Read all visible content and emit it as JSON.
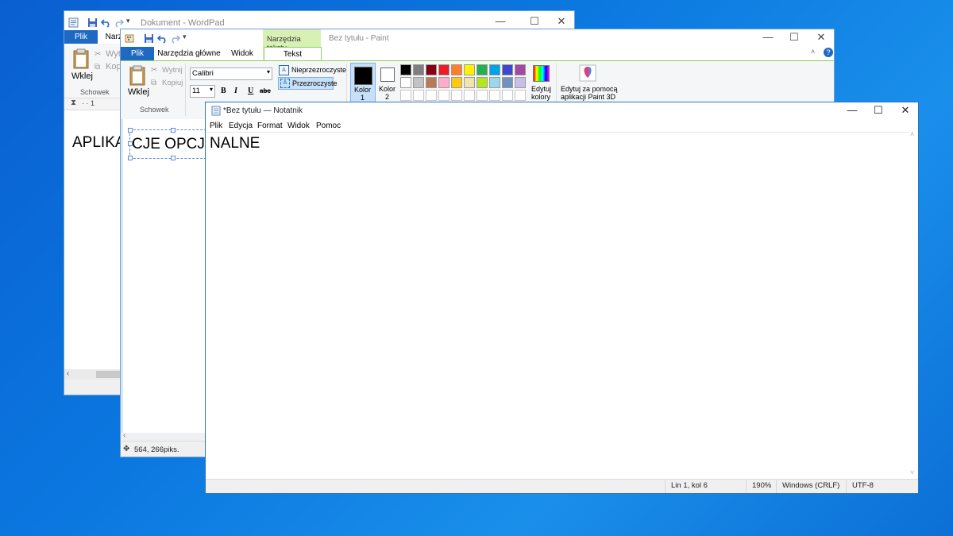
{
  "wordpad": {
    "title": "Dokument - WordPad",
    "tabs": [
      "Plik",
      "Narzę"
    ],
    "paste_label": "Wklej",
    "cut_label": "Wytn",
    "copy_label": "Kopi",
    "group_label": "Schowek",
    "doc_text": "APLIKA",
    "ruler_text": "· · 1"
  },
  "paint": {
    "title": "Bez tytułu - Paint",
    "context_tab": "Narzędzia tekstu",
    "tabs": [
      "Plik",
      "Narzędzia główne",
      "Widok",
      "Tekst"
    ],
    "paste_label": "Wklej",
    "cut_label": "Wytnij",
    "copy_label": "Kopiuj",
    "clipboard_group": "Schowek",
    "font_name": "Calibri",
    "font_size": "11",
    "bold": "B",
    "italic": "I",
    "underline": "U",
    "strike": "abc",
    "opaque_label": "Nieprzezroczyste",
    "transparent_label": "Przezroczyste",
    "color1_label": "Kolor",
    "color1_num": "1",
    "color2_label": "Kolor",
    "color2_num": "2",
    "edit_colors_label1": "Edytuj",
    "edit_colors_label2": "kolory",
    "paint3d_label1": "Edytuj za pomocą",
    "paint3d_label2": "aplikacji Paint 3D",
    "canvas_text": "CJE OPCJO",
    "status_coords": "564, 266piks.",
    "palette_row1": [
      "#000000",
      "#7f7f7f",
      "#880015",
      "#ed1c24",
      "#ff7f27",
      "#fff200",
      "#22b14c",
      "#00a2e8",
      "#3f48cc",
      "#a349a4"
    ],
    "palette_row2": [
      "#ffffff",
      "#c3c3c3",
      "#b97a57",
      "#ffaec9",
      "#ffc90e",
      "#efe4b0",
      "#b5e61d",
      "#99d9ea",
      "#7092be",
      "#c8bfe7"
    ],
    "palette_row3": [
      "#ffffff",
      "#ffffff",
      "#ffffff",
      "#ffffff",
      "#ffffff",
      "#ffffff",
      "#ffffff",
      "#ffffff",
      "#ffffff",
      "#ffffff"
    ],
    "color1_hex": "#000000",
    "color2_hex": "#ffffff",
    "accent": "#0b6cc8"
  },
  "notepad": {
    "title": "*Bez tytułu — Notatnik",
    "menu": [
      "Plik",
      "Edycja",
      "Format",
      "Widok",
      "Pomoc"
    ],
    "content": "NALNE",
    "status": {
      "position": "Lin 1, kol 6",
      "zoom": "190%",
      "line_ending": "Windows (CRLF)",
      "encoding": "UTF-8"
    }
  }
}
